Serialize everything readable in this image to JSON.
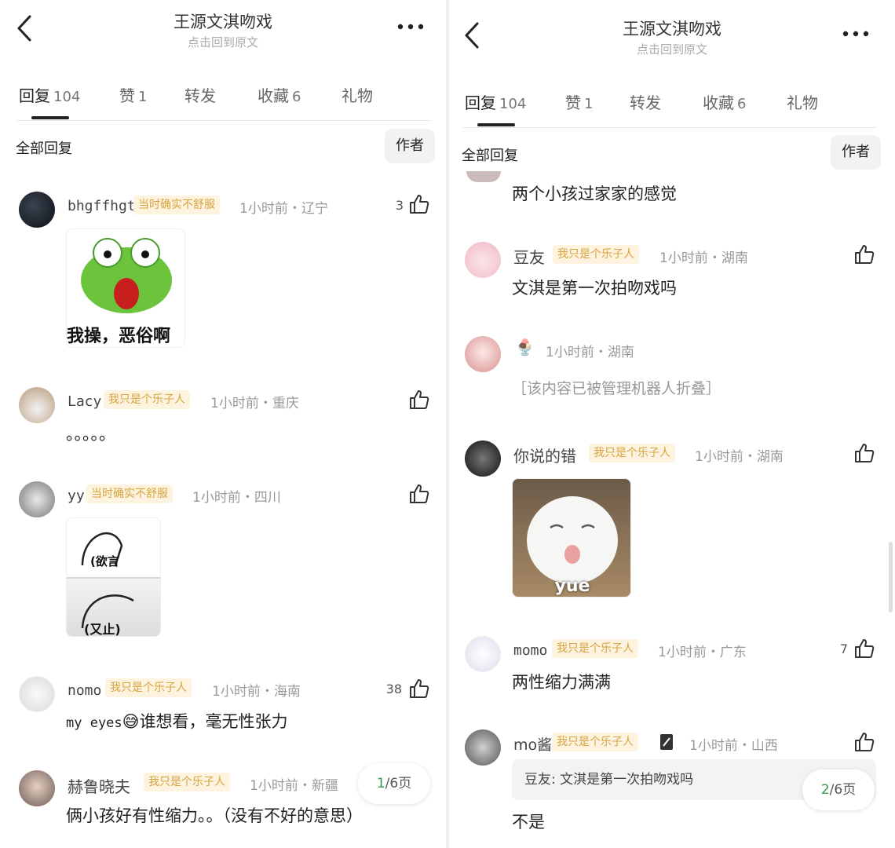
{
  "left": {
    "header": {
      "title": "王源文淇吻戏",
      "subtitle": "点击回到原文"
    },
    "tabs": [
      {
        "label": "回复",
        "count": "104"
      },
      {
        "label": "赞",
        "count": "1"
      },
      {
        "label": "转发",
        "count": ""
      },
      {
        "label": "收藏",
        "count": "6"
      },
      {
        "label": "礼物",
        "count": ""
      }
    ],
    "all_replies_label": "全部回复",
    "author_label": "作者",
    "comments": [
      {
        "username": "bhgffhgt",
        "badge": "当时确实不舒服",
        "meta": "1小时前・辽宁",
        "likes": "3",
        "sticker_text": "我操，恶俗啊"
      },
      {
        "username": "Lacy",
        "badge": "我只是个乐子人",
        "meta": "1小时前・重庆",
        "likes": "",
        "text": "。。。。。"
      },
      {
        "username": "yy",
        "badge": "当时确实不舒服",
        "meta": "1小时前・四川",
        "likes": "",
        "sticker_top": "(欲言",
        "sticker_bottom": "(又止)"
      },
      {
        "username": "nomo",
        "badge": "我只是个乐子人",
        "meta": "1小时前・海南",
        "likes": "38",
        "text_prefix": "my eyes",
        "emoji": "😅",
        "text_suffix": "谁想看，毫无性张力"
      },
      {
        "username": "赫鲁晓夫",
        "badge": "我只是个乐子人",
        "meta": "1小时前・新疆",
        "likes": "",
        "text": "俩小孩好有性缩力。。（没有不好的意思）"
      }
    ],
    "page": {
      "current": "1",
      "total": "/6页"
    }
  },
  "right": {
    "header": {
      "title": "王源文淇吻戏",
      "subtitle": "点击回到原文"
    },
    "tabs": [
      {
        "label": "回复",
        "count": "104"
      },
      {
        "label": "赞",
        "count": "1"
      },
      {
        "label": "转发",
        "count": ""
      },
      {
        "label": "收藏",
        "count": "6"
      },
      {
        "label": "礼物",
        "count": ""
      }
    ],
    "all_replies_label": "全部回复",
    "author_label": "作者",
    "partial_text": "两个小孩过家家的感觉",
    "comments": [
      {
        "username": "豆友",
        "badge": "我只是个乐子人",
        "meta": "1小时前・湖南",
        "likes": "",
        "text": "文淇是第一次拍吻戏吗"
      },
      {
        "username": "",
        "badge_icon": "🍨",
        "meta": "1小时前・湖南",
        "likes": "",
        "folded": "［该内容已被管理机器人折叠］"
      },
      {
        "username": "你说的错",
        "badge": "我只是个乐子人",
        "meta": "1小时前・湖南",
        "likes": "",
        "sticker_text": "yue"
      },
      {
        "username": "momo",
        "badge": "我只是个乐子人",
        "meta": "1小时前・广东",
        "likes": "7",
        "text": "两性缩力满满"
      },
      {
        "username": "mo酱",
        "badge": "我只是个乐子人",
        "meta": "1小时前・山西",
        "likes": "",
        "quote": "豆友: 文淇是第一次拍吻戏吗",
        "text": "不是"
      }
    ],
    "page": {
      "current": "2",
      "total": "/6页"
    }
  }
}
